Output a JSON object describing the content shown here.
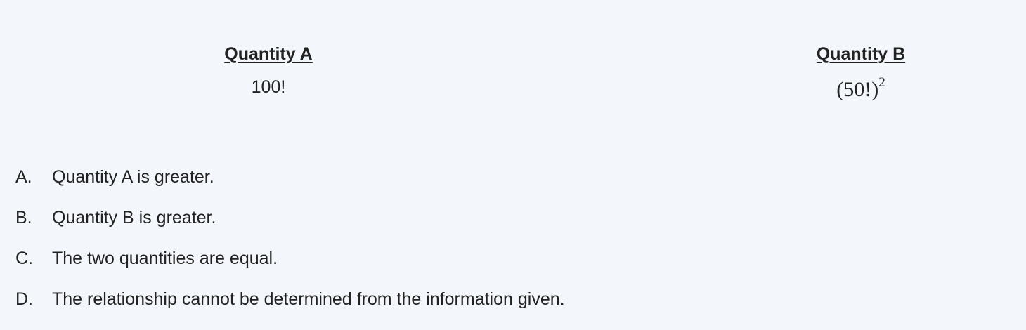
{
  "quantity_a": {
    "header": "Quantity A",
    "value": "100!"
  },
  "quantity_b": {
    "header": "Quantity B",
    "value_base": "(50!)",
    "value_exponent": "2"
  },
  "choices": [
    {
      "letter": "A.",
      "text": "Quantity A is greater."
    },
    {
      "letter": "B.",
      "text": "Quantity B is greater."
    },
    {
      "letter": "C.",
      "text": "The two quantities are equal."
    },
    {
      "letter": "D.",
      "text": "The relationship cannot be determined from the information given."
    }
  ],
  "colors": {
    "background": "#f3f6fa",
    "text": "#222222"
  }
}
